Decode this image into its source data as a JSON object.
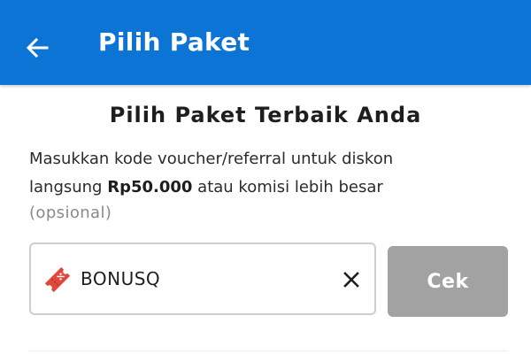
{
  "header": {
    "title": "Pilih Paket",
    "background_color": "#0b74d4",
    "back_icon": "arrow-left-icon"
  },
  "main": {
    "heading": "Pilih Paket Terbaik Anda",
    "description_prefix": "Masukkan kode voucher/referral untuk diskon",
    "description_line2_start": "langsung ",
    "discount_amount": "Rp50.000",
    "description_suffix": " atau komisi lebih besar",
    "optional_label": "(opsional)"
  },
  "voucher": {
    "icon": "ticket-icon",
    "value": "BONUSQ",
    "clear_icon": "close-icon"
  },
  "check_button": {
    "label": "Cek",
    "color": "#a2a2a2"
  }
}
